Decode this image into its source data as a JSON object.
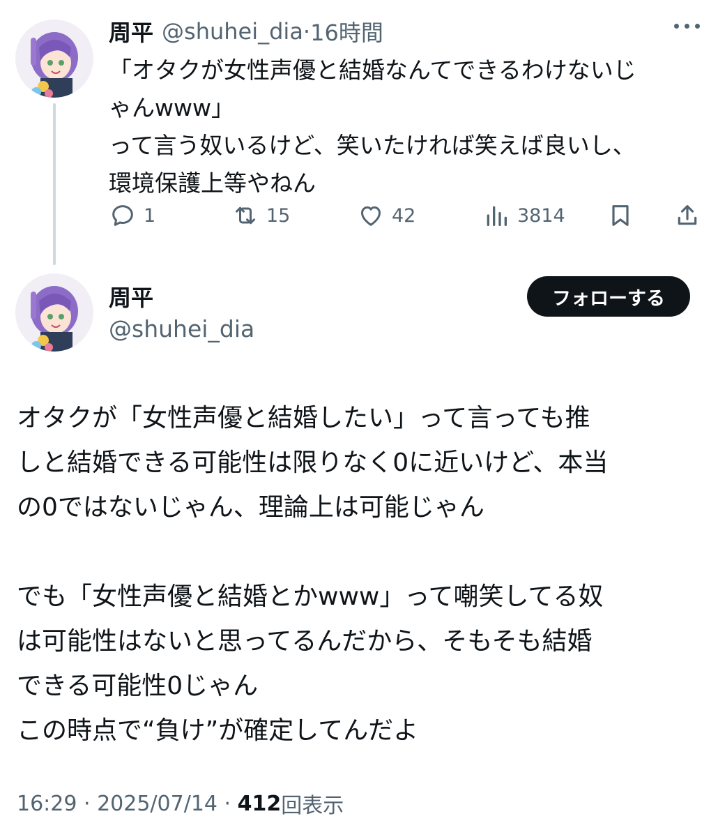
{
  "parent_tweet": {
    "author_name": "周平",
    "handle": "@shuhei_dia",
    "separator": " · ",
    "time": "16時間",
    "more_icon": "more-horizontal-icon",
    "body_lines": [
      "「オタクが女性声優と結婚なんてできるわけないじ",
      "ゃんwww」",
      "って言う奴いるけど、笑いたければ笑えば良いし、",
      "環境保護上等やねん"
    ],
    "actions": {
      "reply": {
        "icon": "reply-icon",
        "count": "1"
      },
      "retweet": {
        "icon": "retweet-icon",
        "count": "15"
      },
      "like": {
        "icon": "heart-icon",
        "count": "42"
      },
      "views": {
        "icon": "analytics-icon",
        "count": "3814"
      },
      "bookmark": {
        "icon": "bookmark-icon"
      },
      "share": {
        "icon": "share-icon"
      }
    }
  },
  "main_tweet": {
    "author_name": "周平",
    "handle": "@shuhei_dia",
    "follow_label": "フォローする",
    "body_lines": [
      "オタクが「女性声優と結婚したい」って言っても推",
      "しと結婚できる可能性は限りなく0に近いけど、本当",
      "の0ではないじゃん、理論上は可能じゃん",
      "",
      "でも「女性声優と結婚とかwww」って嘲笑してる奴",
      "は可能性はないと思ってるんだから、そもそも結婚",
      "できる可能性0じゃん",
      "この時点で“負け”が確定してんだよ"
    ],
    "time": "16:29",
    "date": "2025/07/14",
    "views_count": "412",
    "views_label": "回表示",
    "separator": " · "
  },
  "colors": {
    "text_primary": "#0f1419",
    "text_secondary": "#536471",
    "thread_line": "#cfd9de",
    "follow_bg": "#0f1419"
  }
}
